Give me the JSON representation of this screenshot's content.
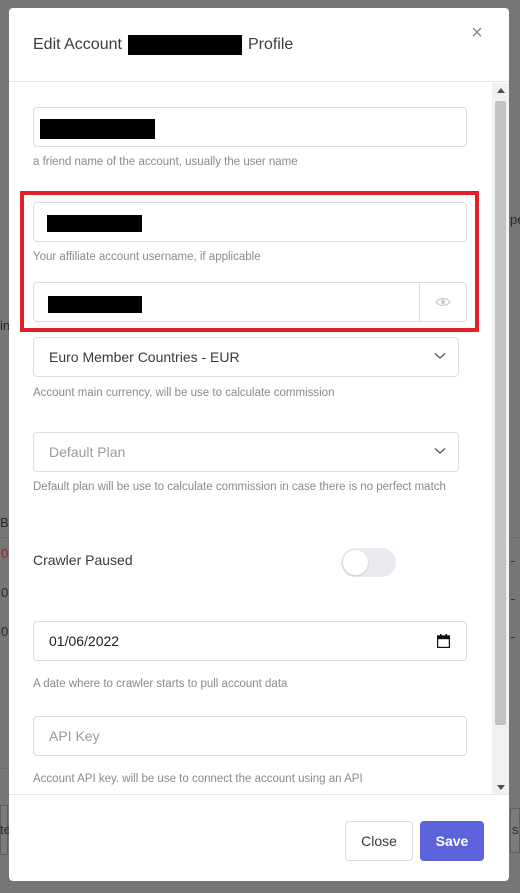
{
  "modal": {
    "title_prefix": "Edit Account",
    "title_suffix": "Profile",
    "close_glyph": "×"
  },
  "fields": {
    "friend_name": {
      "help": "a friend name of the account, usually the user name"
    },
    "affiliate_username": {
      "help": "Your affiliate account username, if applicable"
    },
    "password": {},
    "currency": {
      "value": "Euro Member Countries - EUR",
      "help": "Account main currency, will be use to calculate commission"
    },
    "plan": {
      "placeholder": "Default Plan",
      "help": "Default plan will be use to calculate commission in case there is no perfect match"
    },
    "crawler_paused": {
      "label": "Crawler Paused",
      "enabled": false
    },
    "start_date": {
      "value": "01/06/2022",
      "help": "A date where to crawler starts to pull account data"
    },
    "api_key": {
      "placeholder": "API Key",
      "help": "Account API key. will be use to connect the account using an API"
    }
  },
  "footer": {
    "close_label": "Close",
    "save_label": "Save"
  },
  "background": {
    "frag_in": "in",
    "frag_br": "Br",
    "frag_0a": "0",
    "frag_0b": "0",
    "frag_0c": "0",
    "frag_pe": "pe",
    "frag_te": "te",
    "frag_s": "s"
  },
  "colors": {
    "primary": "#5c63db",
    "highlight": "#e0202a",
    "toggle_off": "#e8eaf0"
  },
  "icons": [
    "close-icon",
    "eye-icon",
    "chevron-down-icon",
    "calendar-icon",
    "scroll-up-icon",
    "scroll-down-icon"
  ]
}
